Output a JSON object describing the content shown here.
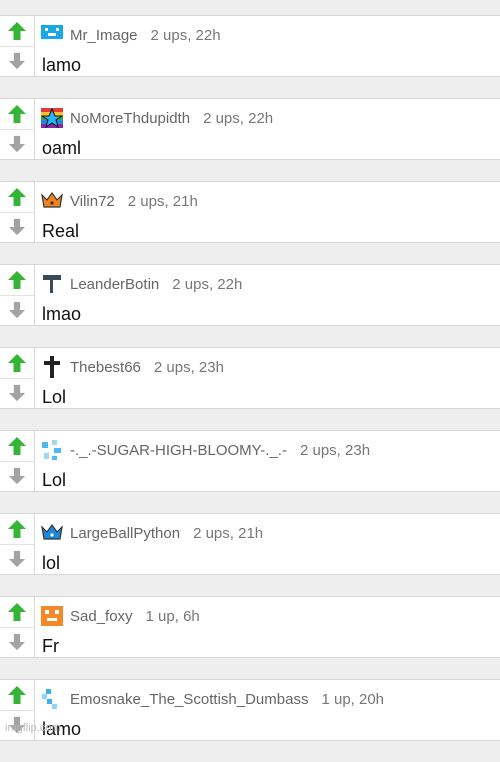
{
  "comments": [
    {
      "badge": "blue-pixel-face-icon",
      "username": "Mr_Image",
      "points": "2 ups, 22h",
      "text": "lamo"
    },
    {
      "badge": "rainbow-star-icon",
      "username": "NoMoreThdupidth",
      "points": "2 ups, 22h",
      "text": "oaml"
    },
    {
      "badge": "orange-crown-icon",
      "username": "Vilin72",
      "points": "2 ups, 21h",
      "text": "Real"
    },
    {
      "badge": "hammer-icon",
      "username": "LeanderBotin",
      "points": "2 ups, 22h",
      "text": "lmao"
    },
    {
      "badge": "cross-icon",
      "username": "Thebest66",
      "points": "2 ups, 23h",
      "text": "Lol"
    },
    {
      "badge": "blue-pixel-fragment-icon",
      "username": "-._.-SUGAR-HIGH-BLOOMY-._.-",
      "points": "2 ups, 23h",
      "text": "Lol"
    },
    {
      "badge": "blue-crown-icon",
      "username": "LargeBallPython",
      "points": "2 ups, 21h",
      "text": "lol"
    },
    {
      "badge": "orange-pixel-face-icon",
      "username": "Sad_foxy",
      "points": "1 up, 6h",
      "text": "Fr"
    },
    {
      "badge": "blue-pixel-snake-icon",
      "username": "Emosnake_The_Scottish_Dumbass",
      "points": "1 up, 20h",
      "text": "lamo"
    }
  ],
  "watermark": "imgflip.com",
  "colors": {
    "upvote": "#35b535",
    "downvote": "#a3a3a3",
    "username": "#666666"
  },
  "icons": {
    "upvote": "up-arrow-icon",
    "downvote": "down-arrow-icon"
  }
}
